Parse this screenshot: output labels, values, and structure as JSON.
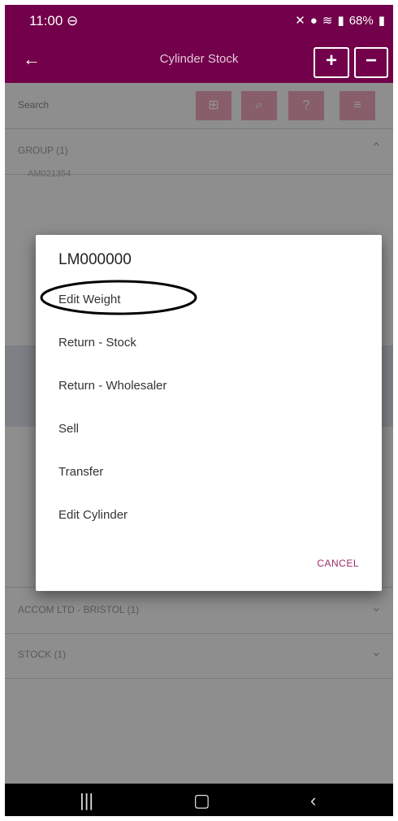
{
  "status_bar": {
    "time": "11:00",
    "battery": "68%"
  },
  "app_bar": {
    "title": "Cylinder Stock",
    "plus_label": "+",
    "minus_label": "−"
  },
  "background": {
    "search_label": "Search",
    "groups": [
      {
        "label": "GROUP (1)"
      },
      {
        "label": "ACCOM LTD - BRISTOL (1)"
      },
      {
        "label": "STOCK (1)"
      }
    ],
    "detail_lines": [
      "AM021354"
    ]
  },
  "dialog": {
    "title": "LM000000",
    "options": [
      "Edit Weight",
      "Return - Stock",
      "Return - Wholesaler",
      "Sell",
      "Transfer",
      "Edit Cylinder"
    ],
    "cancel": "CANCEL"
  },
  "colors": {
    "primary": "#72004a",
    "accent": "#9c2b6b",
    "annotation": "#000000"
  }
}
